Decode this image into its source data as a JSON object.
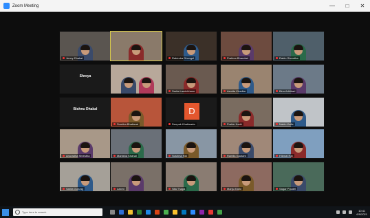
{
  "window": {
    "title": "Zoom Meeting",
    "minimize": "—",
    "maximize": "□",
    "close": "✕"
  },
  "participants": [
    {
      "name": "Jenny Dhakal"
    },
    {
      "name": ""
    },
    {
      "name": "Rabindra Dhungel"
    },
    {
      "name": "Pratima Bhandari"
    },
    {
      "name": "Rabin Shrestha"
    },
    {
      "name": "Shreya",
      "type": "name"
    },
    {
      "name": ""
    },
    {
      "name": "Sarita Lamichhane"
    },
    {
      "name": "Asmita Khadka"
    },
    {
      "name": "Binu Adhikari"
    },
    {
      "name": "Bishnu Dhakal",
      "type": "name"
    },
    {
      "name": "Sumitra Bhattarai"
    },
    {
      "name": "Deepak Khatiwada",
      "type": "avatar",
      "initial": "D"
    },
    {
      "name": "Prabin Karki"
    },
    {
      "name": "Nabin Kafle"
    },
    {
      "name": "Anuradha Shrestha"
    },
    {
      "name": "Manisha Khanal"
    },
    {
      "name": "Sushma Rai"
    },
    {
      "name": "Ramila Gautam"
    },
    {
      "name": "Hikmat Rai"
    },
    {
      "name": "Sarita Gurung"
    },
    {
      "name": "Laxmi"
    },
    {
      "name": "Sita Thapa"
    },
    {
      "name": "Manju Karki"
    },
    {
      "name": "Sagar Poudel"
    }
  ],
  "taskbar": {
    "search_placeholder": "Type here to search",
    "time": "10:41",
    "date": "6/9/2021"
  }
}
